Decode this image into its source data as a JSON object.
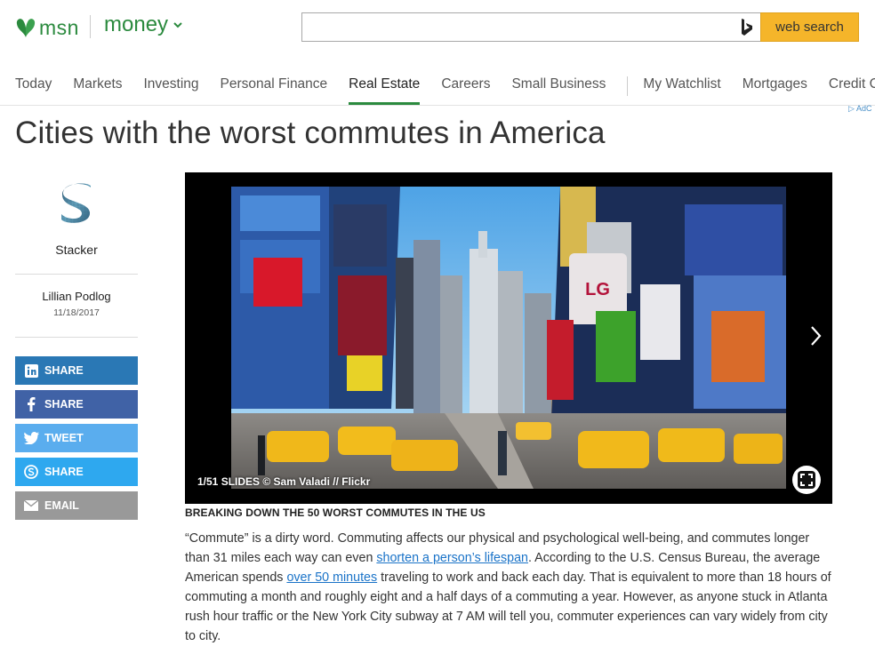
{
  "brand": {
    "msn": "msn",
    "section": "money"
  },
  "search": {
    "placeholder": "",
    "value": "",
    "button_label": "web search"
  },
  "nav": {
    "items": [
      "Today",
      "Markets",
      "Investing",
      "Personal Finance",
      "Real Estate",
      "Careers",
      "Small Business"
    ],
    "items_right": [
      "My Watchlist",
      "Mortgages",
      "Credit Cards"
    ],
    "active": "Real Estate"
  },
  "ad_choices": "AdC",
  "article": {
    "title": "Cities with the worst commutes in America",
    "provider": "Stacker",
    "author": "Lillian Podlog",
    "date": "11/18/2017",
    "section_heading": "BREAKING DOWN THE 50 WORST COMMUTES IN THE US",
    "body": {
      "part1": "“Commute” is a dirty word. Commuting affects our physical and psychological well-being, and commutes longer than 31 miles each way can even ",
      "link1": "shorten a person’s lifespan",
      "part2": ". According to the U.S. Census Bureau, the average American spends ",
      "link2": "over 50 minutes",
      "part3": " traveling to work and back each day. That is equivalent to more than 18 hours of commuting a month and roughly eight and a half days of a commuting a year. However, as anyone stuck in Atlanta rush hour traffic or the New York City subway at 7 AM will tell you, commuter experiences can vary widely from city to city."
    }
  },
  "share": [
    {
      "label": "SHARE",
      "icon": "linkedin-icon",
      "color": "#2a78b5"
    },
    {
      "label": "SHARE",
      "icon": "facebook-icon",
      "color": "#4062a6"
    },
    {
      "label": "TWEET",
      "icon": "twitter-icon",
      "color": "#5aadee"
    },
    {
      "label": "SHARE",
      "icon": "skype-icon",
      "color": "#2ea8ef"
    },
    {
      "label": "EMAIL",
      "icon": "email-icon",
      "color": "#999999"
    }
  ],
  "slideshow": {
    "counter": "1/51 SLIDES",
    "credit": "© Sam Valadi // Flickr",
    "photo_sign": "LG"
  },
  "colors": {
    "brand_green": "#2b8a3e",
    "search_button": "#f5b52a",
    "link": "#1a73c8"
  }
}
